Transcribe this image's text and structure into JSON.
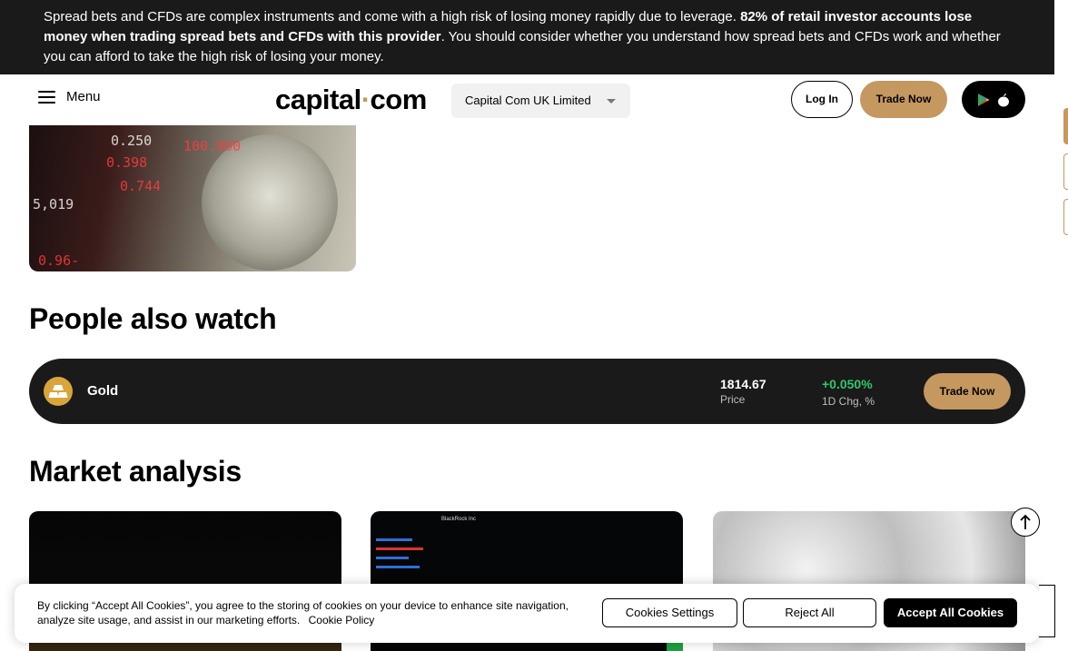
{
  "risk_banner": {
    "text_start": "Spread bets and CFDs are complex instruments and come with a high risk of losing money rapidly due to leverage.",
    "text_bold": "82% of retail investor accounts lose money when trading spread bets and CFDs with this provider",
    "text_end": ". You should consider whether you understand how spread bets and CFDs work and whether you can afford to take the high risk of losing your money."
  },
  "header": {
    "menu_label": "Menu",
    "logo_left": "capital",
    "logo_dot": "·",
    "logo_right": "com",
    "entity_selector": "Capital Com UK Limited",
    "login_label": "Log In",
    "trade_now_label": "Trade Now"
  },
  "hero": {
    "tickers": [
      "0.250",
      "100.000",
      "0.398",
      "0.744",
      "5,019",
      "0.96-"
    ]
  },
  "people_also_watch": {
    "heading": "People also watch",
    "items": [
      {
        "name": "Gold",
        "price": "1814.67",
        "price_label": "Price",
        "change": "+0.050%",
        "change_label": "1D Chg, %",
        "trade_label": "Trade Now"
      }
    ]
  },
  "market_analysis": {
    "heading": "Market analysis",
    "card2_caption": "BlackRock Inc"
  },
  "cookie_banner": {
    "text": "By clicking “Accept All Cookies”, you agree to the storing of cookies on your device to enhance site navigation, analyze site usage, and assist in our marketing efforts.",
    "policy_link": "Cookie Policy",
    "settings_label": "Cookies Settings",
    "reject_label": "Reject All",
    "accept_label": "Accept All Cookies"
  },
  "colors": {
    "accent": "#c4985f",
    "banner_bg": "#1a1a1a",
    "positive": "#2ec76d"
  }
}
